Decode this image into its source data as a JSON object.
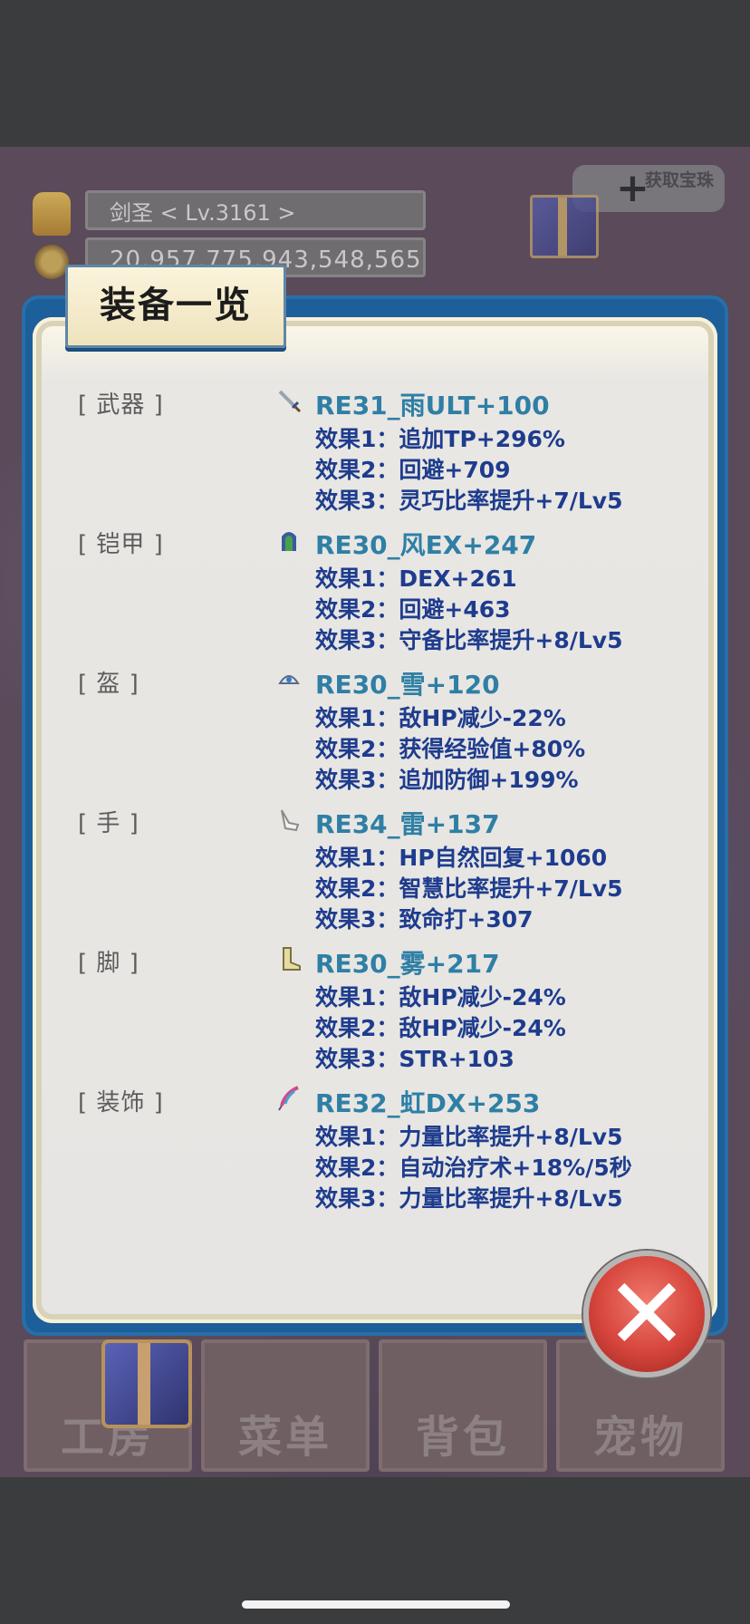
{
  "hud": {
    "player_name": "剑圣    < Lv.3161 >",
    "gold": "20,957,775,943,548,565",
    "treasure_button": "获取宝珠"
  },
  "bottom_nav": [
    {
      "label": "工房"
    },
    {
      "label": "菜单"
    },
    {
      "label": "背包"
    },
    {
      "label": "宠物"
    }
  ],
  "modal": {
    "title": "装备一览",
    "slots": [
      {
        "label": "[ 武器 ]",
        "icon": "sword-icon",
        "item": "RE31_雨ULT+100",
        "effects": [
          "效果1：追加TP+296%",
          "效果2：回避+709",
          "效果3：灵巧比率提升+7/Lv5"
        ]
      },
      {
        "label": "[ 铠甲 ]",
        "icon": "armor-icon",
        "item": "RE30_风EX+247",
        "effects": [
          "效果1：DEX+261",
          "效果2：回避+463",
          "效果3：守备比率提升+8/Lv5"
        ]
      },
      {
        "label": "[ 盔 ]",
        "icon": "helmet-icon",
        "item": "RE30_雪+120",
        "effects": [
          "效果1：敌HP减少-22%",
          "效果2：获得经验值+80%",
          "效果3：追加防御+199%"
        ]
      },
      {
        "label": "[ 手 ]",
        "icon": "glove-icon",
        "item": "RE34_雷+137",
        "effects": [
          "效果1：HP自然回复+1060",
          "效果2：智慧比率提升+7/Lv5",
          "效果3：致命打+307"
        ]
      },
      {
        "label": "[ 脚 ]",
        "icon": "boot-icon",
        "item": "RE30_雾+217",
        "effects": [
          "效果1：敌HP减少-24%",
          "效果2：敌HP减少-24%",
          "效果3：STR+103"
        ]
      },
      {
        "label": "[ 装饰 ]",
        "icon": "feather-icon",
        "item": "RE32_虹DX+253",
        "effects": [
          "效果1：力量比率提升+8/Lv5",
          "效果2：自动治疗术+18%/5秒",
          "效果3：力量比率提升+8/Lv5"
        ]
      }
    ]
  },
  "colors": {
    "item_name": "#2f7fa5",
    "effect_text": "#1e3c8e",
    "modal_frame": "#1d5f9a",
    "close_button": "#d6453c"
  }
}
